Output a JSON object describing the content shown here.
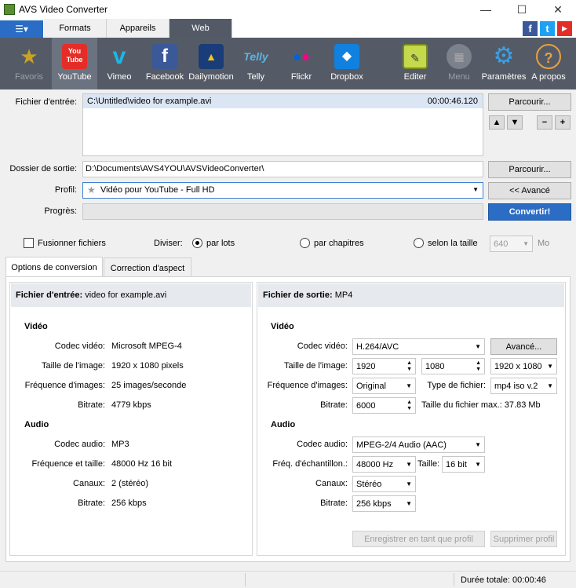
{
  "window": {
    "title": "AVS Video Converter",
    "minimize": "—",
    "maximize": "☐",
    "close": "✕"
  },
  "tabs": {
    "formats": "Formats",
    "devices": "Appareils",
    "web": "Web"
  },
  "menu_icon": "☰▾",
  "social": {
    "facebook": "f",
    "twitter": "t",
    "youtube": "▶"
  },
  "toolbar": {
    "favorites": "Favoris",
    "youtube": "YouTube",
    "vimeo": "Vimeo",
    "facebook": "Facebook",
    "dailymotion": "Dailymotion",
    "telly": "Telly",
    "flickr": "Flickr",
    "dropbox": "Dropbox",
    "edit": "Editer",
    "menu": "Menu",
    "settings": "Paramètres",
    "about": "A propos"
  },
  "input": {
    "label": "Fichier d'entrée:",
    "path": "C:\\Untitled\\video for example.avi",
    "duration": "00:00:46.120",
    "browse": "Parcourir..."
  },
  "output": {
    "label": "Dossier de sortie:",
    "path": "D:\\Documents\\AVS4YOU\\AVSVideoConverter\\",
    "browse": "Parcourir..."
  },
  "profile": {
    "label": "Profil:",
    "value": "Vidéo pour YouTube - Full HD",
    "advanced": "<< Avancé"
  },
  "progress": {
    "label": "Progrès:",
    "value": 0,
    "convert": "Convertir!"
  },
  "split": {
    "merge": "Fusionner fichiers",
    "divide": "Diviser:",
    "by_batch": "par lots",
    "by_chapters": "par chapitres",
    "by_size": "selon la taille",
    "size_value": "640",
    "size_unit": "Mo"
  },
  "subtabs": {
    "options": "Options de conversion",
    "aspect": "Correction d'aspect"
  },
  "left": {
    "head_label": "Fichier d'entrée:",
    "head_value": "video for example.avi",
    "video": "Vidéo",
    "audio": "Audio",
    "rows": [
      {
        "label": "Codec vidéo:",
        "value": "Microsoft MPEG-4"
      },
      {
        "label": "Taille de l'image:",
        "value": "1920 x 1080 pixels"
      },
      {
        "label": "Fréquence d'images:",
        "value": "25 images/seconde"
      },
      {
        "label": "Bitrate:",
        "value": "4779 kbps"
      },
      {
        "label": "Codec audio:",
        "value": "MP3"
      },
      {
        "label": "Fréquence et taille:",
        "value": "48000 Hz 16 bit"
      },
      {
        "label": "Canaux:",
        "value": "2 (stéréo)"
      },
      {
        "label": "Bitrate:",
        "value": "256 kbps"
      }
    ]
  },
  "right": {
    "head_label": "Fichier de sortie:",
    "head_value": "MP4",
    "video": "Vidéo",
    "audio": "Audio",
    "codec_label": "Codec vidéo:",
    "codec": "H.264/AVC",
    "advanced": "Avancé...",
    "size_label": "Taille de l'image:",
    "width": "1920",
    "height": "1080",
    "size_preset": "1920 x 1080",
    "fps_label": "Fréquence d'images:",
    "fps": "Original",
    "filetype_label": "Type de fichier:",
    "filetype": "mp4 iso v.2",
    "bitrate_label": "Bitrate:",
    "bitrate": "6000",
    "maxsize_label": "Taille du fichier max.:",
    "maxsize": "37.83 Mb",
    "acodec_label": "Codec audio:",
    "acodec": "MPEG-2/4 Audio (AAC)",
    "sample_label": "Fréq. d'échantillon.:",
    "sample": "48000 Hz",
    "bits_label": "Taille:",
    "bits": "16 bit",
    "channels_label": "Canaux:",
    "channels": "Stéréo",
    "abitrate_label": "Bitrate:",
    "abitrate": "256 kbps",
    "save_profile": "Enregistrer en tant que profil",
    "delete_profile": "Supprimer profil"
  },
  "status": {
    "total": "Durée totale: 00:00:46"
  }
}
